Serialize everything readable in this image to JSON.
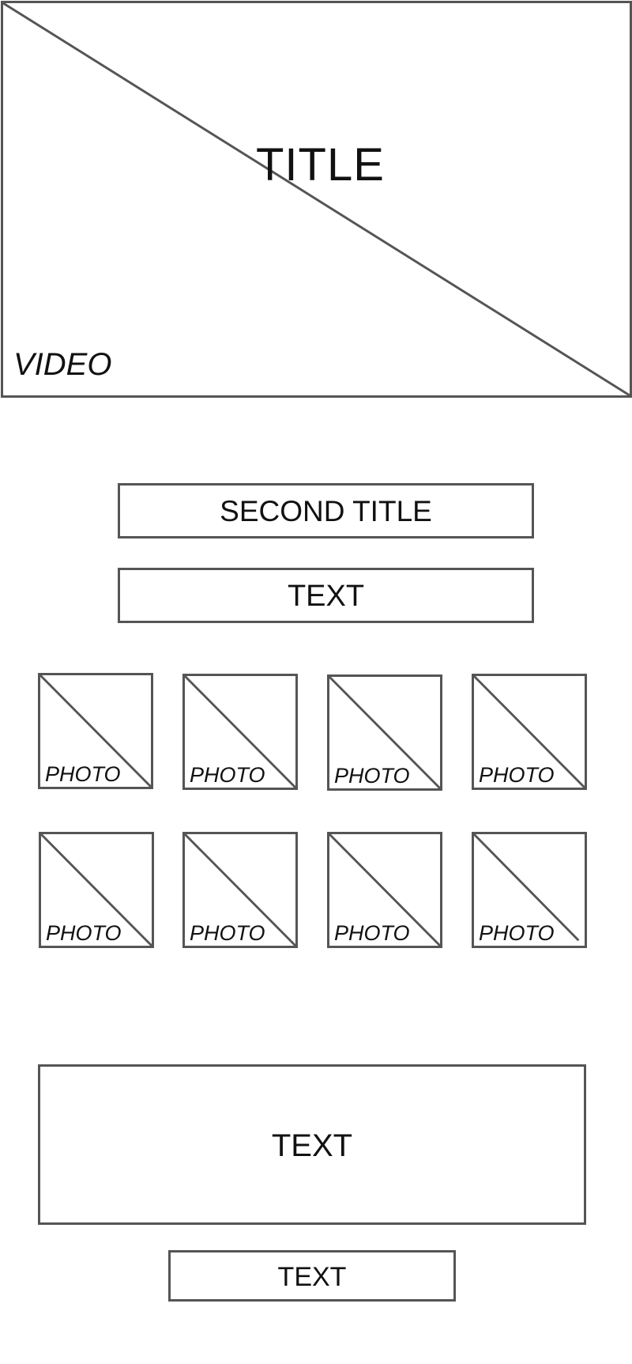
{
  "hero": {
    "title": "TITLE",
    "media_label": "VIDEO"
  },
  "second_title": "SECOND TITLE",
  "text_1": "TEXT",
  "photos": [
    {
      "label": "PHOTO"
    },
    {
      "label": "PHOTO"
    },
    {
      "label": "PHOTO"
    },
    {
      "label": "PHOTO"
    },
    {
      "label": "PHOTO"
    },
    {
      "label": "PHOTO"
    },
    {
      "label": "PHOTO"
    },
    {
      "label": "PHOTO"
    }
  ],
  "text_2": "TEXT",
  "text_3": "TEXT",
  "colors": {
    "stroke": "#555555",
    "text": "#111111",
    "background": "#ffffff"
  },
  "icons": {
    "placeholder": "placeholder-cross-icon"
  }
}
